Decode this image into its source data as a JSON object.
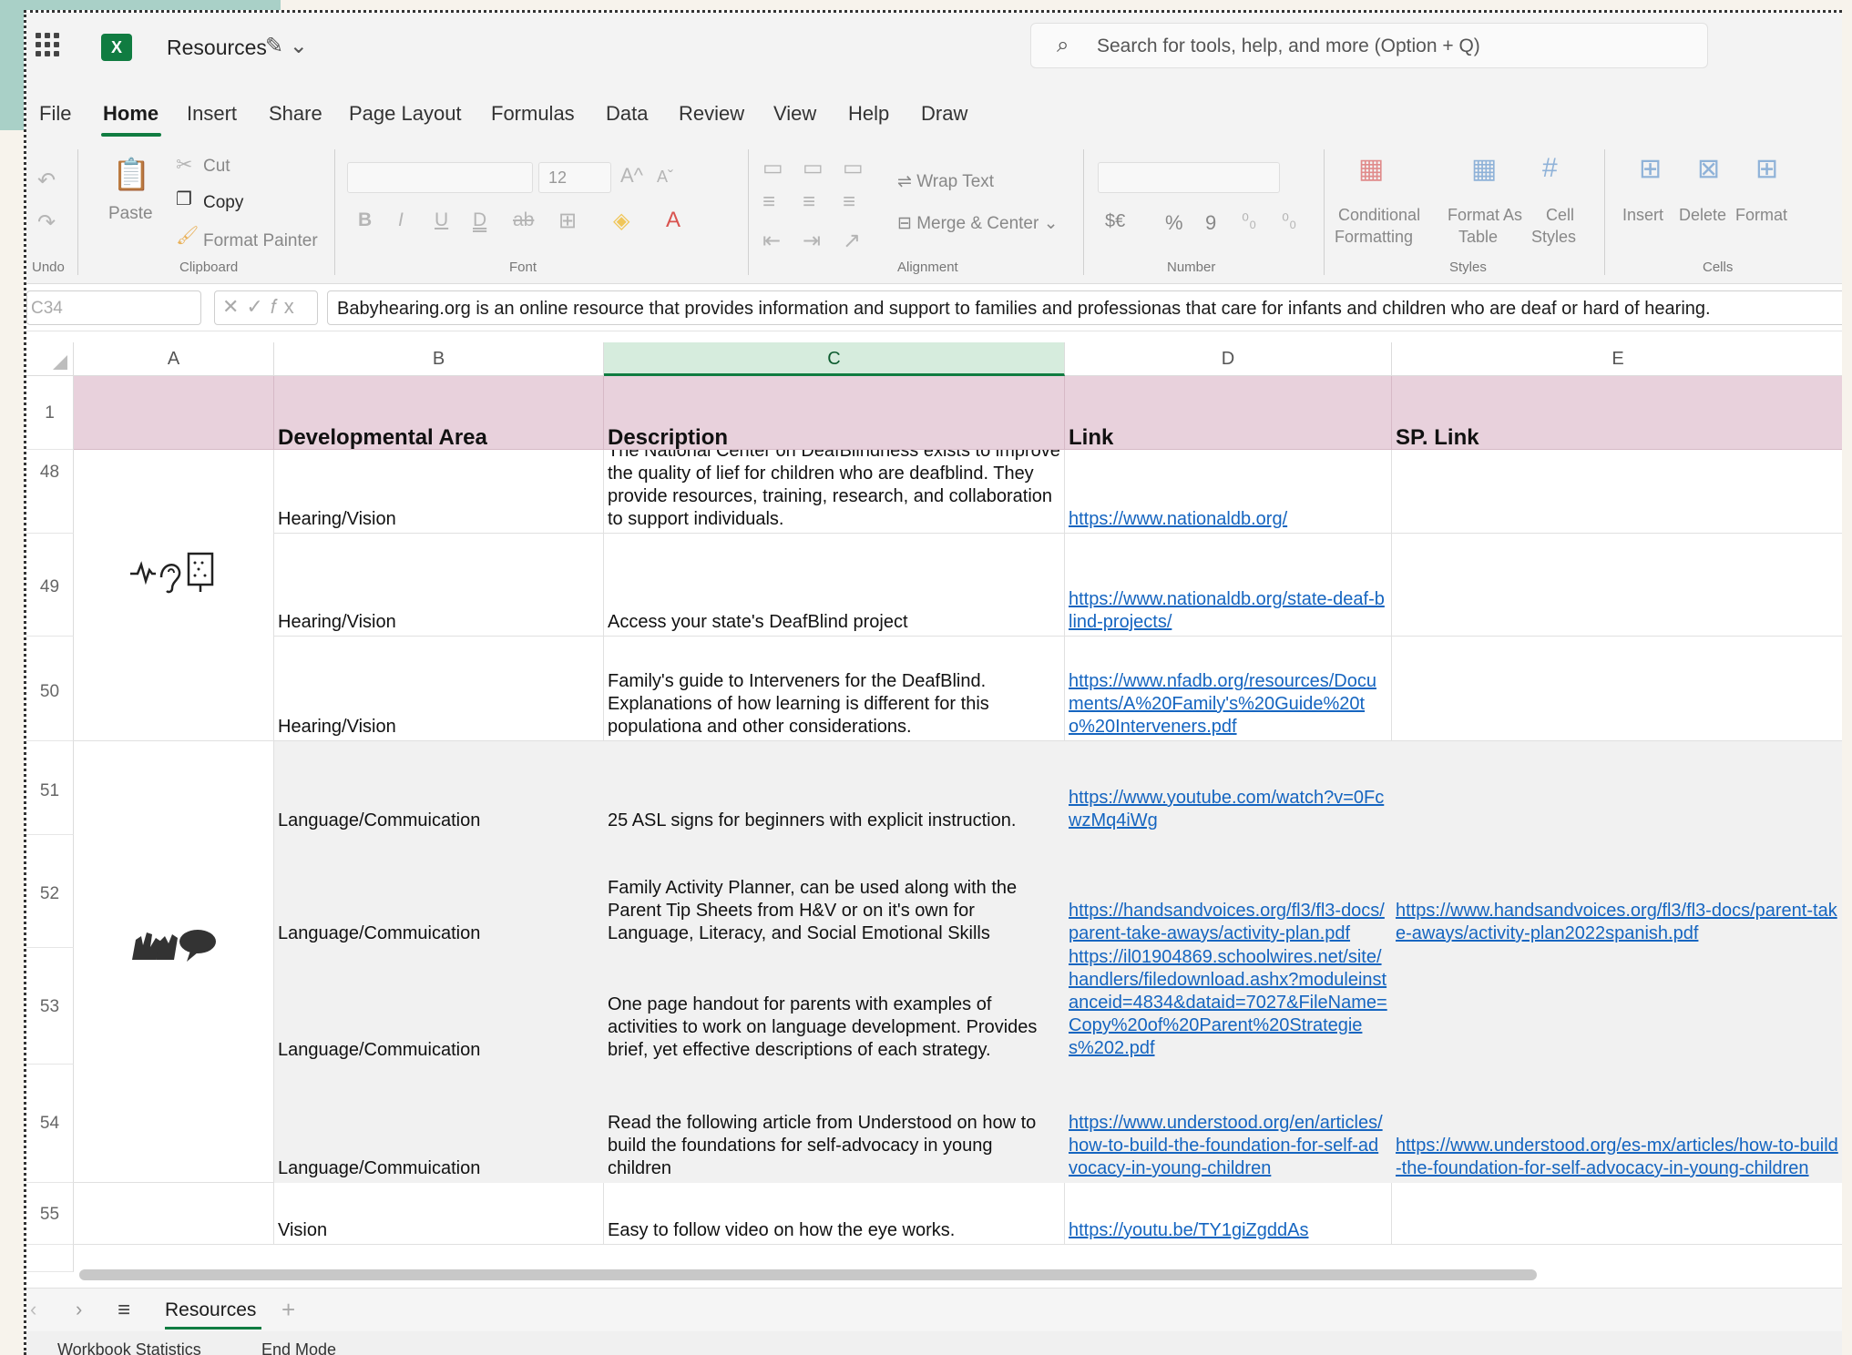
{
  "app": {
    "title": "Resources",
    "search_placeholder": "Search for tools, help, and more (Option + Q)"
  },
  "menu": [
    "File",
    "Home",
    "Insert",
    "Share",
    "Page Layout",
    "Formulas",
    "Data",
    "Review",
    "View",
    "Help",
    "Draw"
  ],
  "ribbon": {
    "undo_group": "Undo",
    "cut": "Cut",
    "copy": "Copy",
    "paste": "Paste",
    "format_painter": "Format Painter",
    "clipboard_group": "Clipboard",
    "font_size": "12",
    "font_group": "Font",
    "wrap_text": "Wrap Text",
    "merge_center": "Merge & Center",
    "alignment_group": "Alignment",
    "number_group": "Number",
    "currency": "$€",
    "percent": "%",
    "comma": "9",
    "conditional_formatting": [
      "Conditional",
      "Formatting"
    ],
    "format_as_table": [
      "Format As",
      "Table"
    ],
    "cell_styles": [
      "Cell",
      "Styles"
    ],
    "styles_group": "Styles",
    "insert": "Insert",
    "delete": "Delete",
    "format": "Format",
    "cells_group": "Cells"
  },
  "formula_bar": {
    "name_box": "C34",
    "formula": "Babyhearing.org is an online resource that provides information and support to families and professionas that care for infants and children who are deaf or hard of hearing."
  },
  "columns": [
    "A",
    "B",
    "C",
    "D",
    "E"
  ],
  "header_row": {
    "row_number": "1",
    "b": "Developmental Area",
    "c": "Description",
    "d": "Link",
    "e": "SP. Link"
  },
  "rows": [
    {
      "num": "48",
      "b": "Hearing/Vision",
      "c": "The National Center on DeafBlindness exists to improve the quality of lief for children who are deafblind. They provide resources, training, research, and collaboration to support individuals.",
      "d": "https://www.nationaldb.org/",
      "e": ""
    },
    {
      "num": "49",
      "b": "Hearing/Vision",
      "c": "Access your state's DeafBlind project",
      "d": "https://www.nationaldb.org/state-deaf-blind-projects/",
      "e": ""
    },
    {
      "num": "50",
      "b": "Hearing/Vision",
      "c": "Family's guide to Interveners for the DeafBlind. Explanations of how learning is different for this populationa and other considerations.",
      "d": "https://www.nfadb.org/resources/Documents/A%20Family's%20Guide%20to%20Interveners.pdf",
      "e": ""
    },
    {
      "num": "51",
      "b": "Language/Commuication",
      "c": "25 ASL signs for beginners with explicit instruction.",
      "d": "https://www.youtube.com/watch?v=0FcwzMq4iWg",
      "e": ""
    },
    {
      "num": "52",
      "b": "Language/Commuication",
      "c": "Family Activity Planner, can be used along with the Parent Tip Sheets from H&V or on it's own for Language, Literacy, and Social Emotional Skills",
      "d": "https://handsandvoices.org/fl3/fl3-docs/parent-take-aways/activity-plan.pdf",
      "e": "https://www.handsandvoices.org/fl3/fl3-docs/parent-take-aways/activity-plan2022spanish.pdf"
    },
    {
      "num": "53",
      "b": "Language/Commuication",
      "c": "One page handout for parents with examples of activities to work on language development. Provides brief, yet effective descriptions of each strategy.",
      "d": "https://il01904869.schoolwires.net/site/handlers/filedownload.ashx?moduleinstanceid=4834&dataid=7027&FileName=Copy%20of%20Parent%20Strategies%202.pdf",
      "e": ""
    },
    {
      "num": "54",
      "b": "Language/Commuication",
      "c": "Read the following article from Understood on how to build the foundations for self-advocacy in young children",
      "d": "https://www.understood.org/en/articles/how-to-build-the-foundation-for-self-advocacy-in-young-children",
      "e": "https://www.understood.org/es-mx/articles/how-to-build-the-foundation-for-self-advocacy-in-young-children"
    },
    {
      "num": "55",
      "b": "Vision",
      "c": "Easy to follow video on how the eye works.",
      "d": "https://youtu.be/TY1giZgddAs",
      "e": ""
    }
  ],
  "sheet_tabs": {
    "active": "Resources",
    "add": "+"
  },
  "status": {
    "workbook_statistics": "Workbook Statistics",
    "mode": "End Mode"
  }
}
